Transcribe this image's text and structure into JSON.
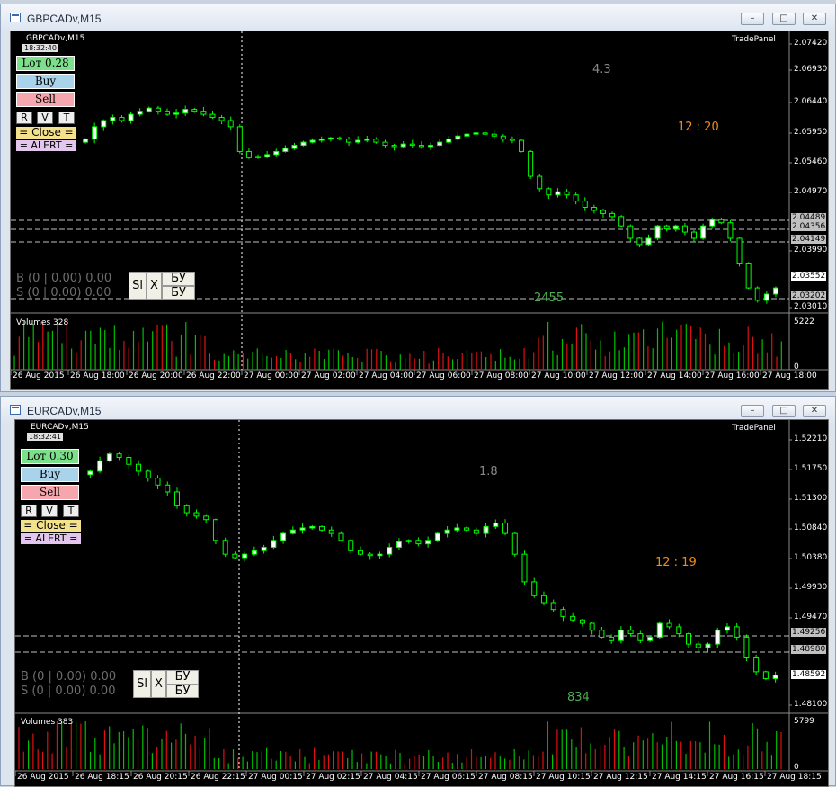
{
  "windows": [
    {
      "title": "GBPCADv,M15",
      "symbol": "GBPCADv,M15",
      "clock": "18:32:40",
      "tradepanel": "TradePanel",
      "lot": "Lот 0.28",
      "buy": "Buy",
      "sell": "Sell",
      "r": "R",
      "v": "V",
      "t": "T",
      "close": "= Close =",
      "alert": "= ALERT =",
      "pos_b": "B (0 | 0.00)  0.00",
      "pos_s": "S (0 | 0.00)  0.00",
      "sl": "Sl",
      "x": "X",
      "bu1": "БУ",
      "bu2": "БУ",
      "spread": "4.3",
      "timer": "12 : 20",
      "vcount": "2455",
      "volumes_label": "Volumes 328",
      "vol_max": "5222",
      "vol_zero": "0",
      "price_ticks": [
        "2.07420",
        "2.06930",
        "2.06440",
        "2.05950",
        "2.05460",
        "2.04970",
        "2.03990",
        "2.03010"
      ],
      "price_boxes": [
        "2.04489",
        "2.04356",
        "2.04149",
        "2.03552",
        "2.03202"
      ],
      "time_ticks": [
        "26 Aug 2015",
        "26 Aug 18:00",
        "26 Aug 20:00",
        "26 Aug 22:00",
        "27 Aug 00:00",
        "27 Aug 02:00",
        "27 Aug 04:00",
        "27 Aug 06:00",
        "27 Aug 08:00",
        "27 Aug 10:00",
        "27 Aug 12:00",
        "27 Aug 14:00",
        "27 Aug 16:00",
        "27 Aug 18:00"
      ]
    },
    {
      "title": "EURCADv,M15",
      "symbol": "EURCADv,M15",
      "clock": "18:32:41",
      "tradepanel": "TradePanel",
      "lot": "Lот 0.30",
      "buy": "Buy",
      "sell": "Sell",
      "r": "R",
      "v": "V",
      "t": "T",
      "close": "= Close =",
      "alert": "= ALERT =",
      "pos_b": "B (0 | 0.00)  0.00",
      "pos_s": "S (0 | 0.00)  0.00",
      "sl": "Sl",
      "x": "X",
      "bu1": "БУ",
      "bu2": "БУ",
      "spread": "1.8",
      "timer": "12 : 19",
      "vcount": "834",
      "volumes_label": "Volumes 383",
      "vol_max": "5799",
      "vol_zero": "0",
      "price_ticks": [
        "1.52210",
        "1.51750",
        "1.51300",
        "1.50840",
        "1.50380",
        "1.49930",
        "1.49470",
        "1.48100"
      ],
      "price_boxes": [
        "1.49256",
        "1.48980",
        "1.48592"
      ],
      "time_ticks": [
        "26 Aug 2015",
        "26 Aug 18:15",
        "26 Aug 20:15",
        "26 Aug 22:15",
        "27 Aug 00:15",
        "27 Aug 02:15",
        "27 Aug 04:15",
        "27 Aug 06:15",
        "27 Aug 08:15",
        "27 Aug 10:15",
        "27 Aug 12:15",
        "27 Aug 14:15",
        "27 Aug 16:15",
        "27 Aug 18:15"
      ]
    }
  ],
  "colors": {
    "bull_body": "#ffffff",
    "wick": "#00ff00",
    "bear_body": "#000000",
    "vol_up": "#00c000",
    "vol_down": "#e01010",
    "dashed": "#c0c0c0"
  },
  "chart_data": [
    {
      "type": "candlestick",
      "symbol": "GBPCADv,M15",
      "price_range": [
        2.0301,
        2.0742
      ],
      "close_series": [
        2.058,
        2.06,
        2.061,
        2.0615,
        2.061,
        2.062,
        2.0625,
        2.063,
        2.0625,
        2.062,
        2.0622,
        2.0628,
        2.0625,
        2.062,
        2.0615,
        2.061,
        2.06,
        2.056,
        2.055,
        2.0552,
        2.0555,
        2.056,
        2.0565,
        2.057,
        2.0575,
        2.0578,
        2.058,
        2.0582,
        2.058,
        2.0575,
        2.0578,
        2.058,
        2.0575,
        2.057,
        2.0568,
        2.0572,
        2.057,
        2.0568,
        2.057,
        2.0575,
        2.058,
        2.0585,
        2.0588,
        2.059,
        2.0588,
        2.0585,
        2.058,
        2.0578,
        2.056,
        2.052,
        2.05,
        2.049,
        2.0495,
        2.049,
        2.048,
        2.047,
        2.0465,
        2.046,
        2.0455,
        2.044,
        2.042,
        2.041,
        2.042,
        2.044,
        2.0435,
        2.044,
        2.043,
        2.042,
        2.044,
        2.045,
        2.0445,
        2.042,
        2.038,
        2.034,
        2.032,
        2.033,
        2.034
      ],
      "volume_range": [
        0,
        5222
      ]
    },
    {
      "type": "candlestick",
      "symbol": "EURCADv,M15",
      "price_range": [
        1.481,
        1.5221
      ],
      "close_series": [
        1.516,
        1.5175,
        1.5185,
        1.518,
        1.517,
        1.516,
        1.515,
        1.514,
        1.513,
        1.511,
        1.51,
        1.5095,
        1.509,
        1.506,
        1.504,
        1.5035,
        1.504,
        1.5045,
        1.505,
        1.506,
        1.507,
        1.5075,
        1.5078,
        1.508,
        1.5075,
        1.507,
        1.506,
        1.5045,
        1.504,
        1.5038,
        1.504,
        1.505,
        1.5058,
        1.506,
        1.5055,
        1.506,
        1.507,
        1.5075,
        1.5078,
        1.5075,
        1.507,
        1.508,
        1.5085,
        1.507,
        1.504,
        1.5,
        1.498,
        1.497,
        1.496,
        1.495,
        1.4945,
        1.494,
        1.493,
        1.492,
        1.4915,
        1.493,
        1.4925,
        1.4915,
        1.492,
        1.494,
        1.4935,
        1.4925,
        1.491,
        1.4905,
        1.491,
        1.493,
        1.4935,
        1.492,
        1.489,
        1.487,
        1.486,
        1.4865
      ],
      "volume_range": [
        0,
        5799
      ]
    }
  ]
}
